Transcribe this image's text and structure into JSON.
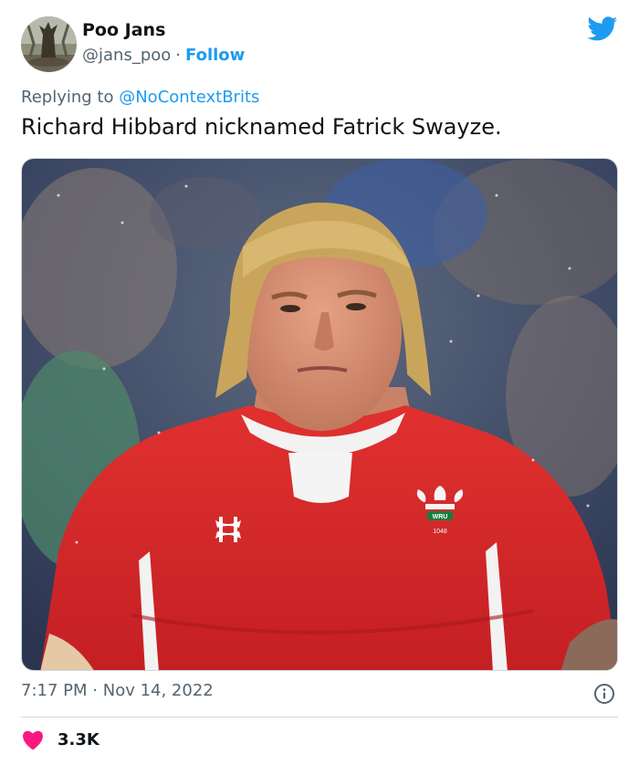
{
  "author": {
    "name": "Poo Jans",
    "handle": "@jans_poo",
    "separator": "·",
    "follow_label": "Follow"
  },
  "reply": {
    "prefix": "Replying to",
    "mention": "@NoContextBrits"
  },
  "tweet": {
    "text": "Richard Hibbard nicknamed Fatrick Swayze."
  },
  "photo": {
    "jersey_badge_text": "WRU",
    "jersey_number_text": "1048"
  },
  "meta": {
    "time": "7:17 PM",
    "separator": "·",
    "date": "Nov 14, 2022"
  },
  "engagement": {
    "likes": "3.3K"
  },
  "icons": {
    "brand": "twitter-bird-icon",
    "info": "info-icon",
    "like": "heart-icon"
  },
  "colors": {
    "accent": "#1d9bf0",
    "like": "#f91880",
    "text_primary": "#0f1419",
    "text_secondary": "#536471",
    "border": "#cfd9de"
  }
}
